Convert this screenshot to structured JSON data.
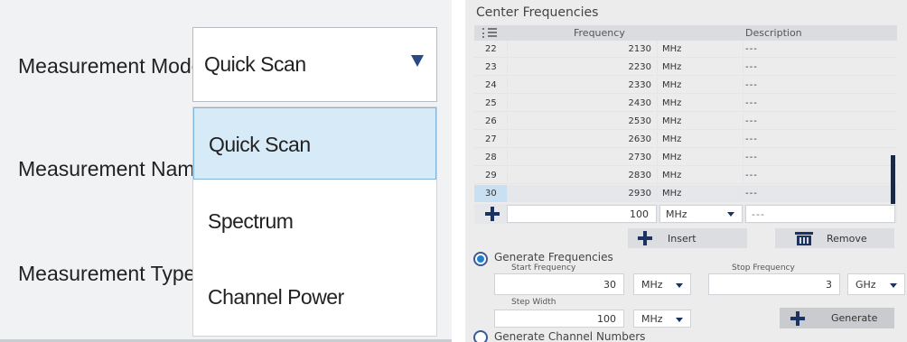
{
  "left": {
    "labels": {
      "measurement_mode": "Measurement Mode",
      "measurement_name": "Measurement Name",
      "measurement_type": "Measurement Type"
    },
    "select": {
      "value": "Quick Scan"
    },
    "dropdown": {
      "options": [
        "Quick Scan",
        "Spectrum",
        "Channel Power"
      ],
      "selected_index": 0
    }
  },
  "right": {
    "title": "Center Frequencies",
    "columns": {
      "frequency": "Frequency",
      "description": "Description"
    },
    "rows": [
      {
        "idx": "22",
        "freq": "2130",
        "unit": "MHz",
        "desc": "---"
      },
      {
        "idx": "23",
        "freq": "2230",
        "unit": "MHz",
        "desc": "---"
      },
      {
        "idx": "24",
        "freq": "2330",
        "unit": "MHz",
        "desc": "---"
      },
      {
        "idx": "25",
        "freq": "2430",
        "unit": "MHz",
        "desc": "---"
      },
      {
        "idx": "26",
        "freq": "2530",
        "unit": "MHz",
        "desc": "---"
      },
      {
        "idx": "27",
        "freq": "2630",
        "unit": "MHz",
        "desc": "---"
      },
      {
        "idx": "28",
        "freq": "2730",
        "unit": "MHz",
        "desc": "---"
      },
      {
        "idx": "29",
        "freq": "2830",
        "unit": "MHz",
        "desc": "---"
      },
      {
        "idx": "30",
        "freq": "2930",
        "unit": "MHz",
        "desc": "---"
      }
    ],
    "new_row": {
      "freq": "100",
      "unit": "MHz",
      "desc": "---"
    },
    "buttons": {
      "insert": "Insert",
      "remove": "Remove",
      "generate": "Generate"
    },
    "generate_frequencies": {
      "label": "Generate Frequencies",
      "start_label": "Start Frequency",
      "start_value": "30",
      "start_unit": "MHz",
      "stop_label": "Stop Frequency",
      "stop_value": "3",
      "stop_unit": "GHz",
      "step_label": "Step Width",
      "step_value": "100",
      "step_unit": "MHz"
    },
    "generate_channel_numbers": {
      "label": "Generate Channel Numbers"
    },
    "colors": {
      "accent": "#1e7fd8",
      "navy": "#1b3362",
      "selection": "#d6eaf7"
    }
  }
}
